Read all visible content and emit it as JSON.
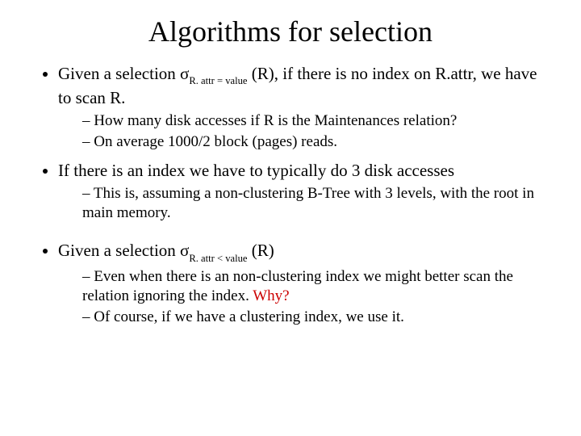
{
  "title": "Algorithms for selection",
  "b1_pre": "Given a selection ",
  "b1_sigma": "σ",
  "b1_sub": "R. attr = value",
  "b1_post": " (R), if there is no index on R.attr, we have to scan R.",
  "b1s1": "How many disk accesses if R is the Maintenances relation?",
  "b1s2": "On average 1000/2 block (pages) reads.",
  "b2": "If there is an index we have to typically do 3 disk accesses",
  "b2s1": "This is, assuming a non-clustering B-Tree with 3 levels, with the root in main memory.",
  "b3_pre": "Given a selection ",
  "b3_sigma": "σ",
  "b3_sub": "R. attr < value",
  "b3_post": " (R)",
  "b3s1_a": "Even when there is an non-clustering index we might better scan the relation ignoring the index. ",
  "b3s1_b": "Why?",
  "b3s2": "Of course, if we have a clustering index, we use it."
}
